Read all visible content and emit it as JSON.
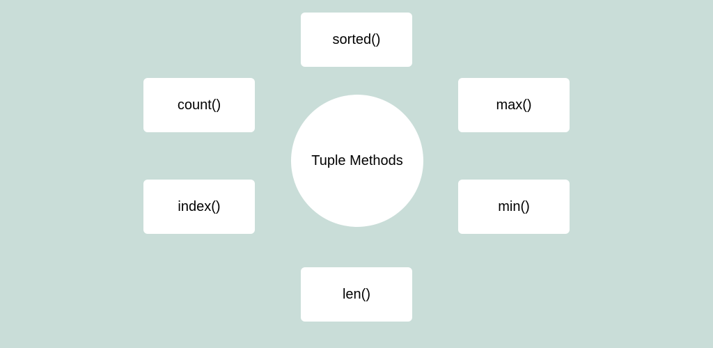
{
  "center": {
    "label": "Tuple Methods"
  },
  "methods": {
    "top": "sorted()",
    "topLeft": "count()",
    "topRight": "max()",
    "bottomLeft": "index()",
    "bottomRight": "min()",
    "bottom": "len()"
  }
}
